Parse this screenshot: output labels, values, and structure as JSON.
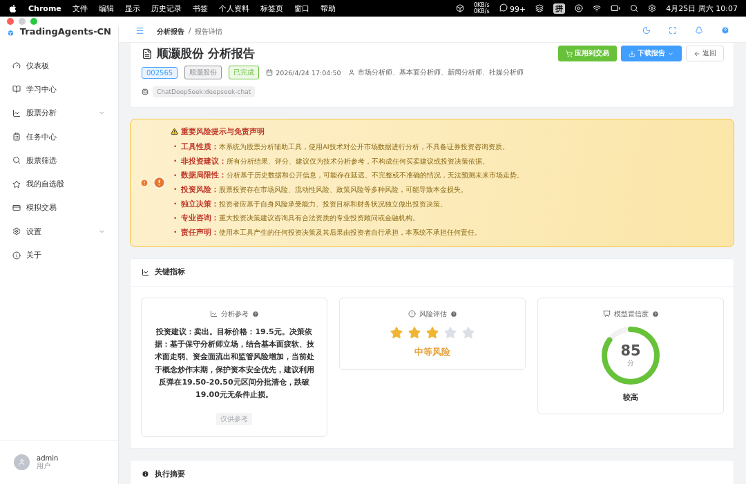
{
  "menu_bar": {
    "app": "Chrome",
    "items": [
      "文件",
      "编辑",
      "显示",
      "历史记录",
      "书签",
      "个人资料",
      "标签页",
      "窗口",
      "帮助"
    ],
    "network_up": "0KB/s",
    "network_down": "0KB/s",
    "notification_count": "99+",
    "input_method": "拼",
    "clock": "4月25日 周六 10:07"
  },
  "sidebar": {
    "brand": "TradingAgents-CN",
    "items": [
      {
        "label": "仪表板",
        "kind": "link",
        "selected": false
      },
      {
        "label": "学习中心",
        "kind": "link",
        "selected": false
      },
      {
        "label": "股票分析",
        "kind": "group",
        "expanded": false,
        "selected": false
      },
      {
        "label": "任务中心",
        "kind": "link",
        "selected": false
      },
      {
        "label": "股票筛选",
        "kind": "link",
        "selected": false
      },
      {
        "label": "我的自选股",
        "kind": "link",
        "selected": false
      },
      {
        "label": "模拟交易",
        "kind": "link",
        "selected": false
      },
      {
        "label": "设置",
        "kind": "group",
        "expanded": false,
        "selected": false
      },
      {
        "label": "关于",
        "kind": "link",
        "selected": false
      }
    ],
    "user": {
      "name": "admin",
      "role": "用户"
    }
  },
  "header": {
    "breadcrumb": [
      "分析报告",
      "报告详情"
    ],
    "separator": "/"
  },
  "report": {
    "title": "顺灏股份 分析报告",
    "tags": [
      {
        "text": "002565",
        "color": "#409eff"
      },
      {
        "text": "顺灏股份",
        "color": "#909399"
      },
      {
        "text": "已完成",
        "color": "#67c23a"
      }
    ],
    "date": "2026/4/24 17:04:50",
    "analysts": "市场分析师、基本面分析师、新闻分析师、社媒分析师",
    "model": "ChatDeepSeek:deepseek-chat",
    "actions": [
      {
        "label": "应用到交易",
        "kind": "trade"
      },
      {
        "label": "下载报告",
        "kind": "download"
      },
      {
        "label": "返回",
        "kind": "back"
      }
    ]
  },
  "disclaimer": {
    "title": "重要风险提示与免责声明",
    "bullet": "•",
    "items": [
      "**工具性质：**本系统为股票分析辅助工具，使用AI技术对公开市场数据进行分析，不具备证券投资咨询资质。",
      "**非投资建议：**所有分析结果、评分、建议仅为技术分析参考，不构成任何买卖建议或投资决策依据。",
      "**数据局限性：**分析基于历史数据和公开信息，可能存在延迟、不完整或不准确的情况，无法预测未来市场走势。",
      "**投资风险：**股票投资存在市场风险、流动性风险、政策风险等多种风险，可能导致本金损失。",
      "**独立决策：**投资者应基于自身风险承受能力、投资目标和财务状况独立做出投资决策。",
      "**专业咨询：**重大投资决策建议咨询具有合法资质的专业投资顾问或金融机构。",
      "**责任声明：**使用本工具产生的任何投资决策及其后果由投资者自行承担，本系统不承担任何责任。"
    ]
  },
  "metrics": {
    "title": "关键指标",
    "cards": [
      {
        "kind": "text",
        "title": "分析参考",
        "body": "投资建议：卖出。目标价格：19.5元。决策依据：基于保守分析师立场，结合基本面疲软、技术面走弱、资金面流出和监管风险增加，当前处于概念炒作末期，保护资本安全优先，建议利用反弹在19.50-20.50元区间分批清仓，跌破19.00元无条件止损。",
        "footnote": "仅供参考"
      },
      {
        "kind": "stars",
        "title": "风险评估",
        "stars": 3,
        "verdict": "中等风险"
      },
      {
        "kind": "gauge",
        "title": "模型置信度",
        "score": "85",
        "unit": "分",
        "level": 0.85,
        "verdict": "较高"
      }
    ]
  },
  "summary": {
    "title": "执行摘要"
  }
}
